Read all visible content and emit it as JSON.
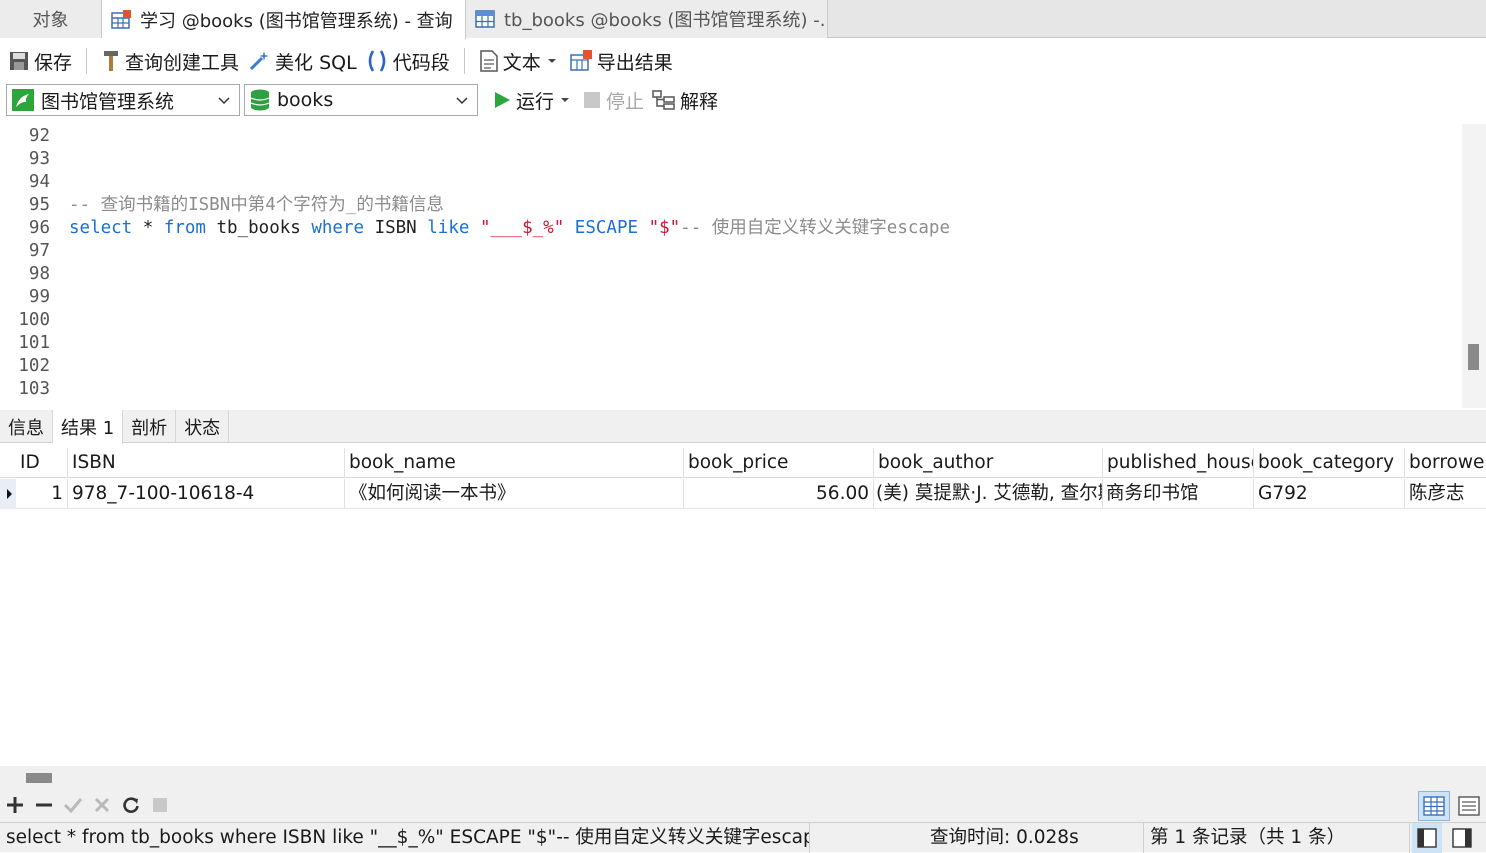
{
  "tabs": {
    "objects": "对象",
    "query_tab": "学习 @books (图书馆管理系统) - 查询",
    "table_tab": "tb_books @books (图书馆管理系统) -..."
  },
  "toolbar": {
    "save": "保存",
    "query_builder": "查询创建工具",
    "beautify_sql": "美化 SQL",
    "code_snippet": "代码段",
    "text": "文本",
    "export_results": "导出结果"
  },
  "connection": {
    "connection_name": "图书馆管理系统",
    "database": "books",
    "run": "运行",
    "stop": "停止",
    "explain": "解释"
  },
  "editor": {
    "lines": [
      {
        "num": "92",
        "text": ""
      },
      {
        "num": "93",
        "text": ""
      },
      {
        "num": "94",
        "text": ""
      },
      {
        "num": "95",
        "text": "-- 查询书籍的ISBN中第4个字符为_的书籍信息"
      },
      {
        "num": "96",
        "text": "select * from tb_books where ISBN like \"___$_%\" ESCAPE \"$\"-- 使用自定义转义关键字escape"
      },
      {
        "num": "97",
        "text": ""
      },
      {
        "num": "98",
        "text": ""
      },
      {
        "num": "99",
        "text": ""
      },
      {
        "num": "100",
        "text": ""
      },
      {
        "num": "101",
        "text": ""
      },
      {
        "num": "102",
        "text": ""
      },
      {
        "num": "103",
        "text": ""
      }
    ],
    "line96": {
      "t1": "select",
      "t2": " * ",
      "t3": "from",
      "t4": " tb_books ",
      "t5": "where",
      "t6": " ISBN ",
      "t7": "like",
      "t8": " ",
      "t9": "\"___$_%\"",
      "t10": " ",
      "t11": "ESCAPE",
      "t12": " ",
      "t13": "\"$\"",
      "t14": "-- 使用自定义转义关键字escape"
    }
  },
  "result_tabs": [
    "信息",
    "结果 1",
    "剖析",
    "状态"
  ],
  "grid": {
    "columns": [
      "ID",
      "ISBN",
      "book_name",
      "book_price",
      "book_author",
      "published_house",
      "book_category",
      "borrower"
    ],
    "rows": [
      [
        "1",
        "978_7-100-10618-4",
        "《如何阅读一本书》",
        "56.00",
        "(美) 莫提默·J. 艾德勒, 查尔斯",
        "商务印书馆",
        "G792",
        "陈彦志"
      ]
    ]
  },
  "status": {
    "sql": "select * from tb_books where ISBN like \"__$_%\" ESCAPE \"$\"-- 使用自定义转义关键字escape",
    "query_time": "查询时间: 0.028s",
    "record": "第 1 条记录（共 1 条）"
  }
}
